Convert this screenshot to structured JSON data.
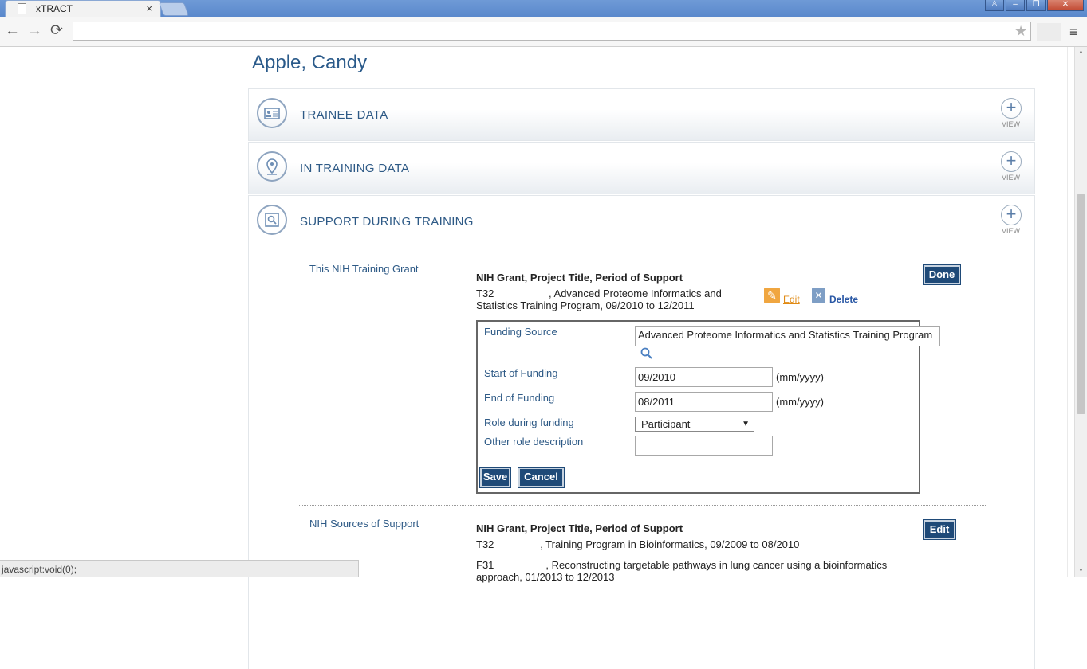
{
  "browser": {
    "tab_title": "xTRACT",
    "tab_close": "×",
    "window_buttons": {
      "user": "♙",
      "minimize": "–",
      "maximize": "❐",
      "close": "✕"
    },
    "nav": {
      "back": "←",
      "forward": "→",
      "reload": "⟳"
    },
    "address_value": "",
    "star": "★",
    "menu": "≡",
    "status_url": "javascript:void(0);"
  },
  "page": {
    "person_name": "Apple, Candy",
    "panels": [
      {
        "title": "TRAINEE DATA",
        "icon": "id-card-icon",
        "view_label": "VIEW"
      },
      {
        "title": "IN TRAINING DATA",
        "icon": "location-pin-icon",
        "view_label": "VIEW"
      },
      {
        "title": "SUPPORT DURING TRAINING",
        "icon": "search-document-icon",
        "view_label": "VIEW"
      }
    ],
    "plus": "+"
  },
  "support": {
    "this_grant": {
      "label": "This NIH Training Grant",
      "header": "NIH Grant, Project Title, Period of Support",
      "line1": "T32                   , Advanced Proteome Informatics and",
      "line2": "Statistics Training Program, 09/2010 to 12/2011",
      "done_label": "Done",
      "edit_label": "Edit",
      "delete_label": "Delete"
    },
    "form": {
      "funding_source_label": "Funding Source",
      "funding_source_value": "Advanced Proteome Informatics and Statistics Training Program",
      "start_label": "Start of Funding",
      "start_value": "09/2010",
      "end_label": "End of Funding",
      "end_value": "08/2011",
      "date_format": "(mm/yyyy)",
      "role_label": "Role during funding",
      "role_value": "Participant",
      "other_role_label": "Other role description",
      "other_role_value": "",
      "save_label": "Save",
      "cancel_label": "Cancel"
    },
    "nih_sources": {
      "label": "NIH Sources of Support",
      "header": "NIH Grant, Project Title, Period of Support",
      "edit_label": "Edit",
      "rows": [
        "T32                , Training Program in Bioinformatics, 09/2009 to 08/2010",
        "F31                  , Reconstructing targetable pathways in lung cancer using a bioinformatics",
        "approach, 01/2013 to 12/2013"
      ]
    }
  }
}
